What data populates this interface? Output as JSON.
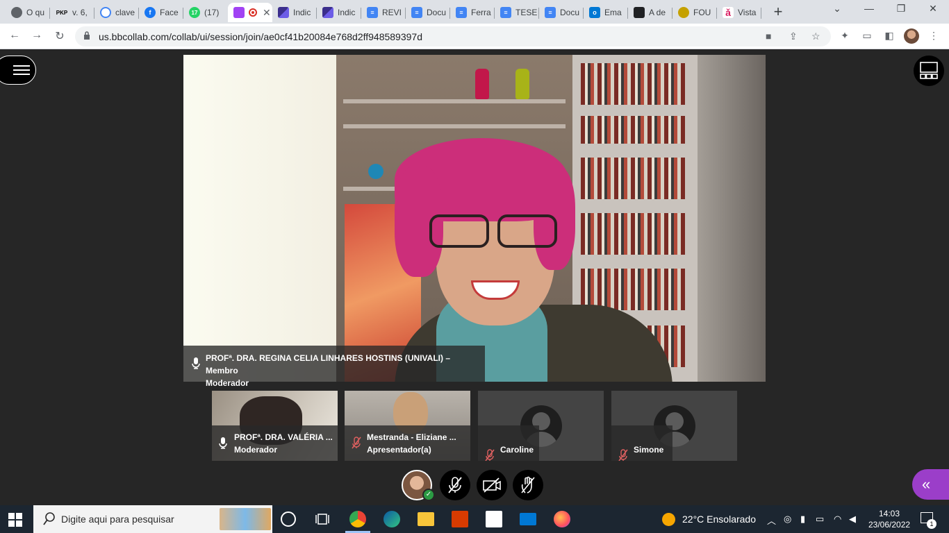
{
  "browser": {
    "tabs": [
      {
        "label": "O qu",
        "color": "#5f6368"
      },
      {
        "label": "v. 6,",
        "color": "#3c4043"
      },
      {
        "label": "clave",
        "color": "#4285f4"
      },
      {
        "label": "Face",
        "color": "#1877f2"
      },
      {
        "label": "(17)",
        "color": "#25d366"
      },
      {
        "label": "",
        "color": "#a142f4",
        "active": true
      },
      {
        "label": "Indic",
        "color": "#3b2e8c"
      },
      {
        "label": "Indic",
        "color": "#3b2e8c"
      },
      {
        "label": "REVI",
        "color": "#4285f4"
      },
      {
        "label": "Docu",
        "color": "#4285f4"
      },
      {
        "label": "Ferra",
        "color": "#4285f4"
      },
      {
        "label": "TESE",
        "color": "#4285f4"
      },
      {
        "label": "Docu",
        "color": "#4285f4"
      },
      {
        "label": "Ema",
        "color": "#0078d4"
      },
      {
        "label": "A de",
        "color": "#202124"
      },
      {
        "label": "FOU",
        "color": "#c5a100"
      },
      {
        "label": "Vista",
        "color": "#d81b60"
      }
    ],
    "tab_icon_text": {
      "pkp": "PKP",
      "wa": "17"
    },
    "new_tab": "+",
    "url": "us.bbcollab.com/collab/ui/session/join/ae0cf41b20084e768d2ff948589397d"
  },
  "collab": {
    "main_speaker": {
      "name_line1": "PROFª. DRA. REGINA CELIA LINHARES HOSTINS (UNIVALI) – Membro",
      "name_line2": "Moderador"
    },
    "participants": [
      {
        "name": "PROFª. DRA. VALÉRIA ...",
        "role": "Moderador",
        "mic": "on"
      },
      {
        "name": "Mestranda - Eliziane ...",
        "role": "Apresentador(a)",
        "mic": "muted"
      },
      {
        "name": "Caroline",
        "role": "",
        "mic": "muted"
      },
      {
        "name": "Simone",
        "role": "",
        "mic": "muted"
      }
    ],
    "status_check": "✓",
    "panel_icon": "«"
  },
  "taskbar": {
    "search_placeholder": "Digite aqui para pesquisar",
    "weather": "22°C  Ensolarado",
    "time": "14:03",
    "date": "23/06/2022",
    "notification_count": "1"
  }
}
